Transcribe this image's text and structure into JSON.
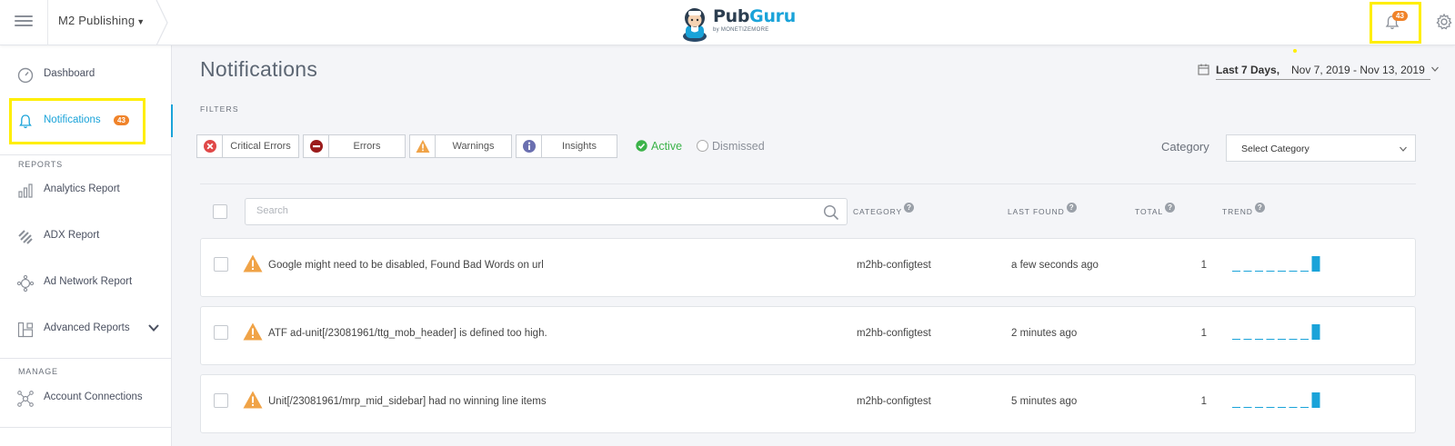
{
  "header": {
    "publisher": "M2 Publishing",
    "brand_left": "Pub",
    "brand_right": "Guru",
    "brand_byline": "by MONETIZEMORE",
    "notification_count": "43"
  },
  "sidebar": {
    "items": [
      {
        "label": "Dashboard",
        "icon": "dashboard-gauge-icon"
      },
      {
        "label": "Notifications",
        "icon": "bell-icon",
        "badge": "43",
        "active": true
      }
    ],
    "reports_title": "REPORTS",
    "reports": [
      {
        "label": "Analytics Report",
        "icon": "bar-chart-icon"
      },
      {
        "label": "ADX Report",
        "icon": "adx-stripes-icon"
      },
      {
        "label": "Ad Network Report",
        "icon": "ad-network-icon"
      },
      {
        "label": "Advanced Reports",
        "icon": "advanced-reports-icon"
      }
    ],
    "manage_title": "MANAGE",
    "manage": [
      {
        "label": "Account Connections",
        "icon": "connections-icon"
      }
    ]
  },
  "page": {
    "title": "Notifications",
    "date_preset": "Last 7 Days,",
    "date_range": "Nov 7, 2019 - Nov 13, 2019",
    "filters_label": "FILTERS",
    "filter_buttons": [
      "Critical Errors",
      "Errors",
      "Warnings",
      "Insights"
    ],
    "status_options": [
      "Active",
      "Dismissed"
    ],
    "selected_status": "Active",
    "category_label": "Category",
    "category_placeholder": "Select Category",
    "search_placeholder": "Search"
  },
  "table": {
    "columns": [
      "CATEGORY",
      "LAST FOUND",
      "TOTAL",
      "TREND"
    ],
    "rows": [
      {
        "message": "Google might need to be disabled, Found Bad Words on url",
        "category": "m2hb-configtest",
        "last_found": "a few seconds ago",
        "total": "1",
        "trend": [
          0,
          0,
          0,
          0,
          0,
          0,
          0,
          1
        ]
      },
      {
        "message": "ATF ad-unit[/23081961/ttg_mob_header] is defined too high.",
        "category": "m2hb-configtest",
        "last_found": "2 minutes ago",
        "total": "1",
        "trend": [
          0,
          0,
          0,
          0,
          0,
          0,
          0,
          1
        ]
      },
      {
        "message": "Unit[/23081961/mrp_mid_sidebar] had no winning line items",
        "category": "m2hb-configtest",
        "last_found": "5 minutes ago",
        "total": "1",
        "trend": [
          0,
          0,
          0,
          0,
          0,
          0,
          0,
          1
        ]
      }
    ]
  },
  "colors": {
    "accent": "#1aa3d9",
    "badge": "#f0832a",
    "warning": "#f0a347",
    "active_green": "#3cb34a",
    "highlight": "#ffee00"
  }
}
